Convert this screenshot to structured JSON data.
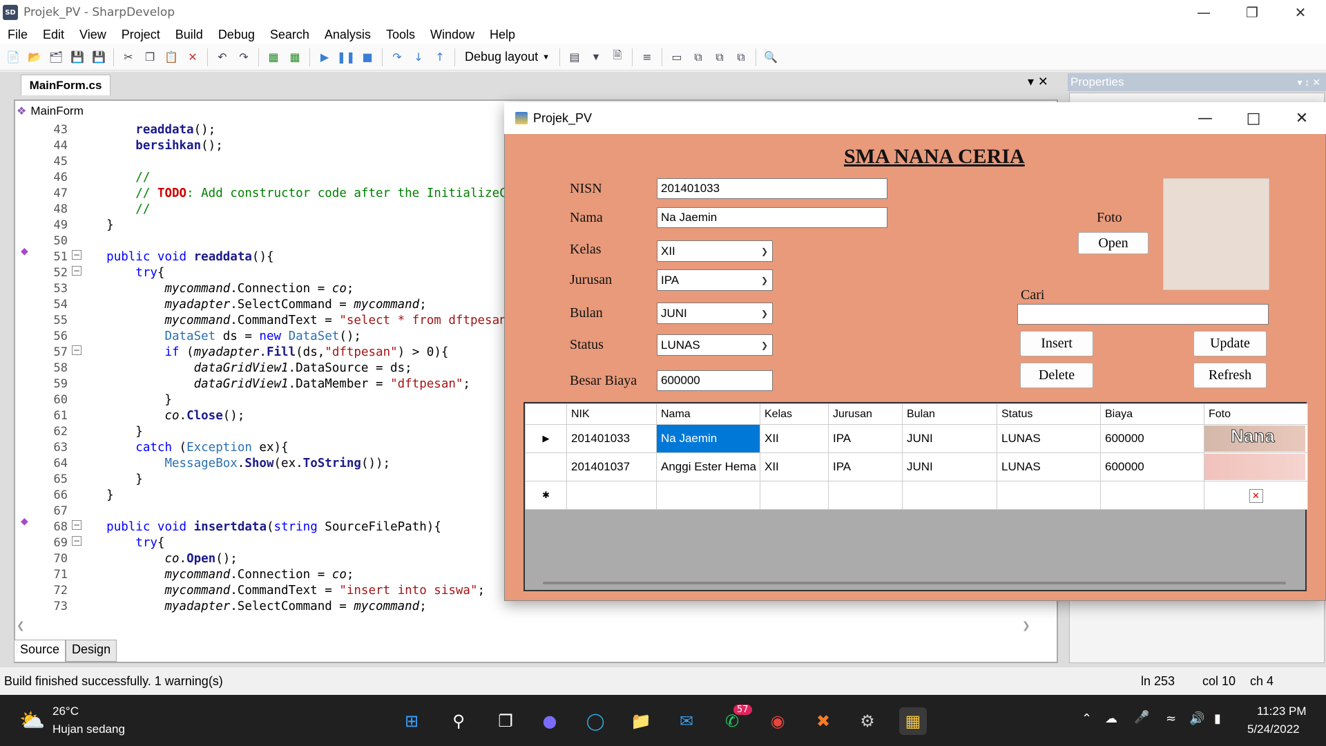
{
  "window": {
    "title": "Projek_PV - SharpDevelop"
  },
  "menu": [
    "File",
    "Edit",
    "View",
    "Project",
    "Build",
    "Debug",
    "Search",
    "Analysis",
    "Tools",
    "Window",
    "Help"
  ],
  "toolbar": {
    "layout_dropdown": "Debug layout"
  },
  "editor": {
    "tab": "MainForm.cs",
    "class_selector": "MainForm",
    "line_numbers": [
      "43",
      "44",
      "45",
      "46",
      "47",
      "48",
      "49",
      "50",
      "51",
      "52",
      "53",
      "54",
      "55",
      "56",
      "57",
      "58",
      "59",
      "60",
      "61",
      "62",
      "63",
      "64",
      "65",
      "66",
      "67",
      "68",
      "69",
      "70",
      "71",
      "72",
      "73"
    ],
    "bottom_tabs": [
      "Source",
      "Design"
    ]
  },
  "properties": {
    "title": "Properties"
  },
  "status": {
    "message": "Build finished successfully. 1 warning(s)",
    "ln": "ln 253",
    "col": "col 10",
    "ch": "ch 4"
  },
  "form": {
    "title": "Projek_PV",
    "heading": "SMA NANA CERIA",
    "labels": {
      "nisn": "NISN",
      "nama": "Nama",
      "kelas": "Kelas",
      "jurusan": "Jurusan",
      "bulan": "Bulan",
      "status": "Status",
      "biaya": "Besar Biaya",
      "foto": "Foto",
      "cari": "Cari"
    },
    "values": {
      "nisn": "201401033",
      "nama": "Na Jaemin",
      "kelas": "XII",
      "jurusan": "IPA",
      "bulan": "JUNI",
      "status": "LUNAS",
      "biaya": "600000",
      "cari": ""
    },
    "buttons": {
      "open": "Open",
      "insert": "Insert",
      "update": "Update",
      "delete": "Delete",
      "refresh": "Refresh"
    },
    "grid": {
      "columns": [
        "NIK",
        "Nama",
        "Kelas",
        "Jurusan",
        "Bulan",
        "Status",
        "Biaya",
        "Foto"
      ],
      "rows": [
        [
          "201401033",
          "Na Jaemin",
          "XII",
          "IPA",
          "JUNI",
          "LUNAS",
          "600000"
        ],
        [
          "201401037",
          "Anggi Ester Hema",
          "XII",
          "IPA",
          "JUNI",
          "LUNAS",
          "600000"
        ]
      ],
      "thumb_text": "Nana"
    }
  },
  "taskbar": {
    "weather_temp": "26°C",
    "weather_desc": "Hujan sedang",
    "time": "11:23 PM",
    "date": "5/24/2022",
    "whatsapp_badge": "57"
  }
}
